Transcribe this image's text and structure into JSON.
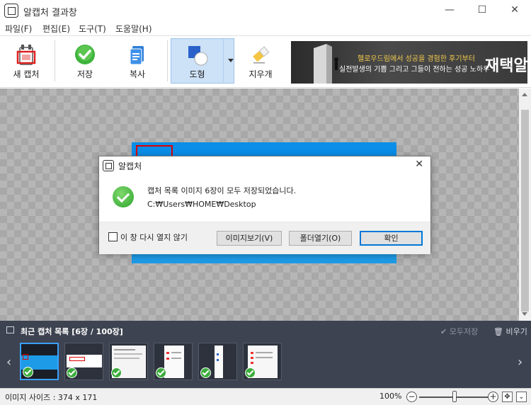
{
  "window": {
    "title": "알캡처 결과창",
    "minimize": "—",
    "maximize": "☐",
    "close": "✕"
  },
  "menu": {
    "items": [
      "파일(F)",
      "편집(E)",
      "도구(T)",
      "도움말(H)"
    ]
  },
  "toolbar": {
    "new_capture": "새 캡처",
    "save": "저장",
    "copy": "복사",
    "shape": "도형",
    "eraser": "지우개"
  },
  "ad": {
    "line1": "헬로우드림에서 성공을 경험한 후기부터",
    "line2": "실전발생의 기쁨 그리고 그들이 전하는 성공 노하우",
    "big": "재택알"
  },
  "dialog": {
    "title": "알캡처",
    "close": "✕",
    "message": "캡처 목록 이미지 6장이 모두 저장되었습니다.",
    "path": "C:₩Users₩HOME₩Desktop",
    "dont_show": "이 창 다시 열지 않기",
    "view_image": "이미지보기(V)",
    "open_folder": "폴더열기(O)",
    "ok": "확인"
  },
  "recent": {
    "title": "최근 캡처 목록 [6장 / 100장]",
    "save_all": "✔ 모두저장",
    "clear": "🗑 비우기",
    "prev": "‹",
    "next": "›",
    "thumbnails": [
      {
        "label": "thumbnail-1",
        "selected": true
      },
      {
        "label": "thumbnail-2",
        "selected": false
      },
      {
        "label": "thumbnail-3",
        "selected": false
      },
      {
        "label": "thumbnail-4",
        "selected": false
      },
      {
        "label": "thumbnail-5",
        "selected": false
      },
      {
        "label": "thumbnail-6",
        "selected": false
      }
    ]
  },
  "status": {
    "image_size": "이미지 사이즈 : 374 x 171",
    "zoom": "100%",
    "zoom_out": "−",
    "zoom_in": "+",
    "zoom_level": 0.5
  },
  "colors": {
    "accent": "#0078d7",
    "capture_blue": "#1e9be6",
    "panel_bg": "#3d4350",
    "check_green": "#3cad3c"
  }
}
